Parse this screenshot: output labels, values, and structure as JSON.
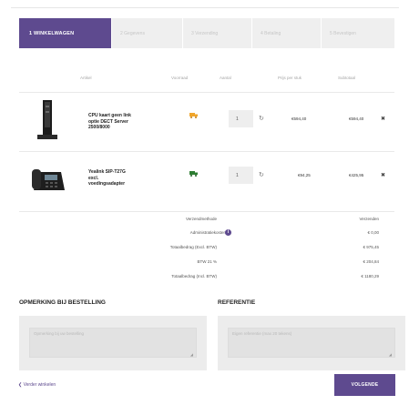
{
  "steps": [
    {
      "label": "1  WINKELWAGEN",
      "active": true
    },
    {
      "label": "2  Gegevens",
      "active": false
    },
    {
      "label": "3  Verzending",
      "active": false
    },
    {
      "label": "4  Betaling",
      "active": false
    },
    {
      "label": "5  Bevestigen",
      "active": false
    }
  ],
  "table": {
    "headers": {
      "item": "Artikel",
      "stock": "Voorraad",
      "qty": "Aantal",
      "unit": "Prijs per stuk",
      "subtotal": "Subtotaal"
    },
    "rows": [
      {
        "name": "CPU kaart geen link\noptie DECT Server\n2500/8000",
        "qty": "1",
        "unit_price": "€594,40",
        "subtotal": "€594,40",
        "stock_color": "#f0a52b"
      },
      {
        "name": "Yealink SIP-T27G\nexcl.\nvoedingsadapter",
        "qty": "1",
        "unit_price": "€94,25",
        "subtotal": "€425,95",
        "stock_color": "#2e7d32"
      }
    ]
  },
  "totals": {
    "rows": [
      {
        "label": "Verzendmethode",
        "value": "Verzenden"
      },
      {
        "label": "Administratiekosten",
        "value": "€ 0,00"
      },
      {
        "label": "Totaalbedrag (Excl. BTW)",
        "value": "€ 975,45"
      },
      {
        "label": "BTW 21 %",
        "value": "€ 204,84"
      },
      {
        "label": "Totaalbedrag (Incl. BTW)",
        "value": "€ 1180,29"
      }
    ]
  },
  "remark": {
    "title": "OPMERKING BIJ BESTELLING",
    "placeholder": "Opmerking bij uw bestelling"
  },
  "reference": {
    "title": "REFERENTIE",
    "placeholder": "Eigen referentie (max 20 tekens)"
  },
  "footer": {
    "back_label": "❮ Verder winkelen",
    "next_label": "VOLGENDE"
  },
  "colors": {
    "accent": "#5e4a8f"
  }
}
